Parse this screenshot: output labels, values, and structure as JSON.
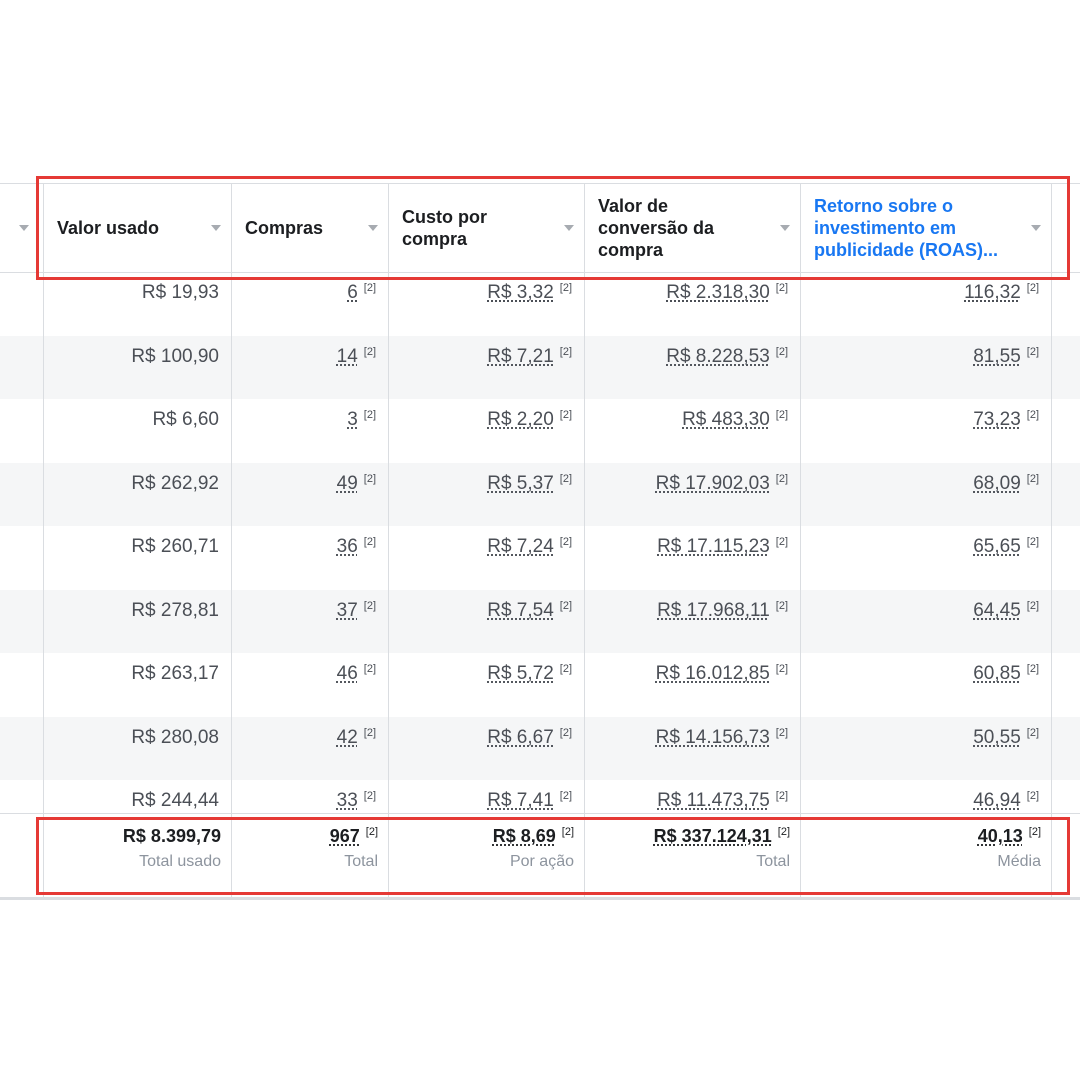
{
  "columns": [
    {
      "label": "Valor usado"
    },
    {
      "label": "Compras"
    },
    {
      "label": "Custo por compra"
    },
    {
      "label": "Valor de conversão da compra"
    },
    {
      "label": "Retorno sobre o investimento em publicidade (ROAS)..."
    }
  ],
  "rows": [
    {
      "valor": "R$ 19,93",
      "compras": "6",
      "custo": "R$ 3,32",
      "conversao": "R$ 2.318,30",
      "roas": "116,32"
    },
    {
      "valor": "R$ 100,90",
      "compras": "14",
      "custo": "R$ 7,21",
      "conversao": "R$ 8.228,53",
      "roas": "81,55"
    },
    {
      "valor": "R$ 6,60",
      "compras": "3",
      "custo": "R$ 2,20",
      "conversao": "R$ 483,30",
      "roas": "73,23"
    },
    {
      "valor": "R$ 262,92",
      "compras": "49",
      "custo": "R$ 5,37",
      "conversao": "R$ 17.902,03",
      "roas": "68,09"
    },
    {
      "valor": "R$ 260,71",
      "compras": "36",
      "custo": "R$ 7,24",
      "conversao": "R$ 17.115,23",
      "roas": "65,65"
    },
    {
      "valor": "R$ 278,81",
      "compras": "37",
      "custo": "R$ 7,54",
      "conversao": "R$ 17.968,11",
      "roas": "64,45"
    },
    {
      "valor": "R$ 263,17",
      "compras": "46",
      "custo": "R$ 5,72",
      "conversao": "R$ 16.012,85",
      "roas": "60,85"
    },
    {
      "valor": "R$ 280,08",
      "compras": "42",
      "custo": "R$ 6,67",
      "conversao": "R$ 14.156,73",
      "roas": "50,55"
    },
    {
      "valor": "R$ 244,44",
      "compras": "33",
      "custo": "R$ 7,41",
      "conversao": "R$ 11.473,75",
      "roas": "46,94"
    }
  ],
  "footnote_marker": "[2]",
  "totals": {
    "valor": {
      "value": "R$ 8.399,79",
      "label": "Total usado"
    },
    "compras": {
      "value": "967",
      "label": "Total"
    },
    "custo": {
      "value": "R$ 8,69",
      "label": "Por ação"
    },
    "conversao": {
      "value": "R$ 337.124,31",
      "label": "Total"
    },
    "roas": {
      "value": "40,13",
      "label": "Média"
    }
  },
  "colors": {
    "highlight": "#e53935",
    "active_header": "#1877f2",
    "alt_row": "#f5f6f7"
  }
}
